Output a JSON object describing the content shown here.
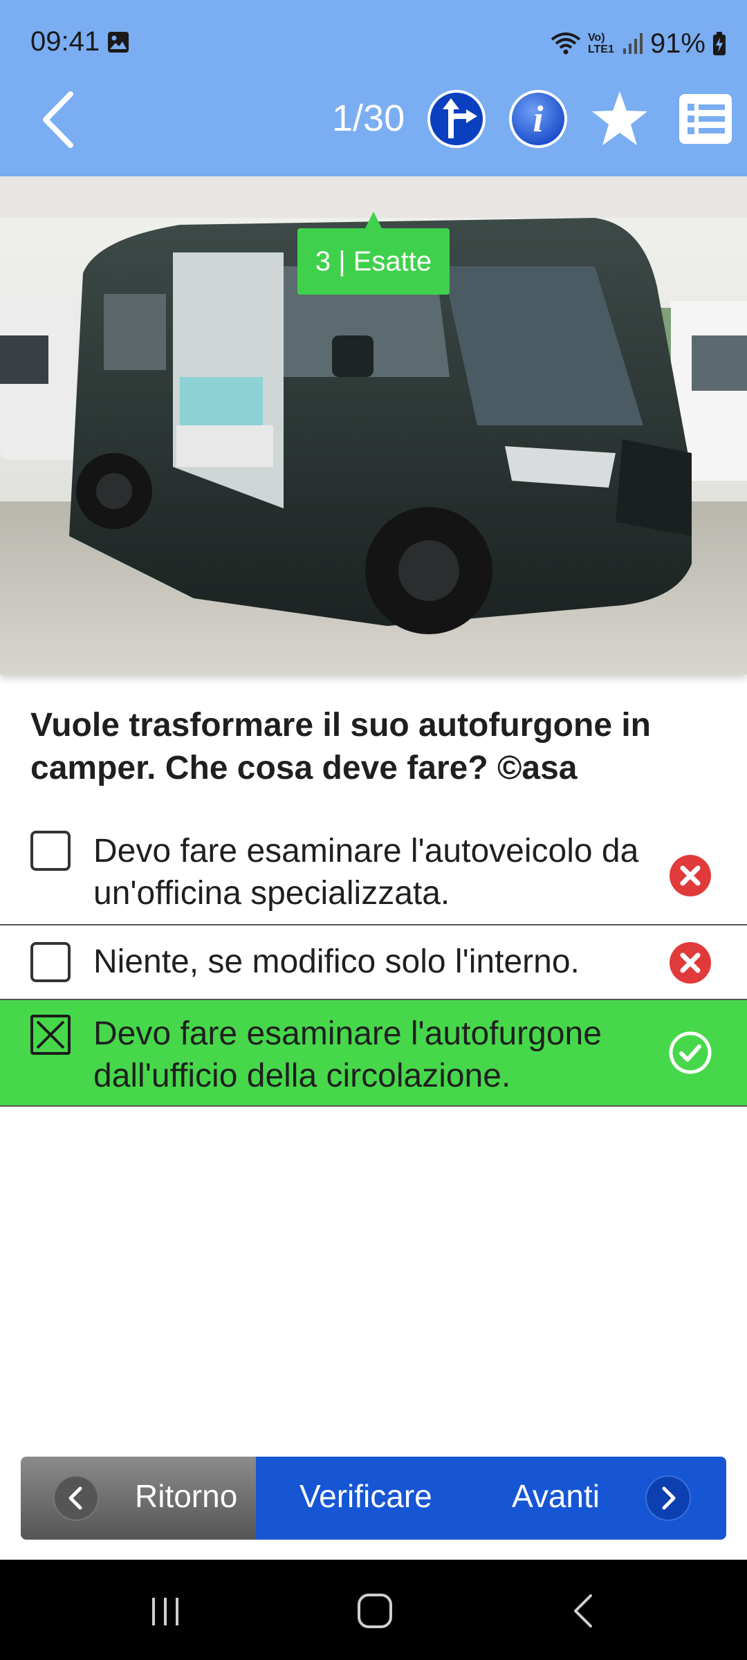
{
  "status_bar": {
    "time": "09:41",
    "network": "Vo) LTE1",
    "battery": "91%",
    "icons": [
      "gallery-icon",
      "wifi-icon",
      "signal-icon",
      "battery-icon"
    ]
  },
  "header": {
    "counter": "1/30",
    "icons": [
      "back-arrow-icon",
      "road-sign-icon",
      "info-icon",
      "star-icon",
      "list-icon"
    ],
    "colors": {
      "bar": "#7aadf2",
      "sign_blue": "#0a3fbf"
    }
  },
  "photo": {
    "badge": "3 | Esatte",
    "badge_color": "#3fd14b"
  },
  "question": {
    "text": "Vuole trasformare il suo autofurgone in camper. Che cosa deve fare? ©asa"
  },
  "answers": [
    {
      "text": "Devo fare esaminare l'autoveicolo da un'officina specializzata.",
      "checked": false,
      "result": "wrong"
    },
    {
      "text": "Niente, se modifico solo l'interno.",
      "checked": false,
      "result": "wrong"
    },
    {
      "text": "Devo fare esaminare l'autofurgone dall'ufficio della circolazione.",
      "checked": true,
      "result": "correct"
    }
  ],
  "bottom_nav": {
    "back_label": "Ritorno",
    "verify_label": "Verificare",
    "next_label": "Avanti",
    "colors": {
      "main": "#1656d4",
      "back": "#6e6e6e"
    }
  },
  "system_nav": {
    "icons": [
      "recent-apps-icon",
      "home-icon",
      "system-back-icon"
    ]
  }
}
